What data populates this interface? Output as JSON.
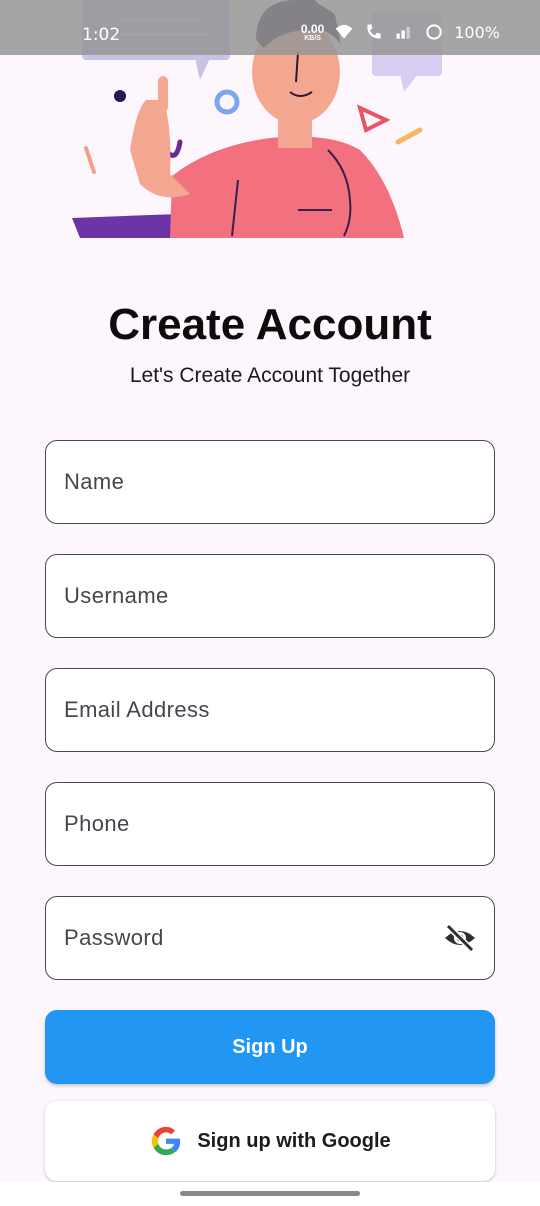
{
  "status_bar": {
    "time": "1:02",
    "net_speed": "0.00",
    "net_unit": "KB/S",
    "battery": "100%"
  },
  "header": {
    "title": "Create Account",
    "subtitle": "Let's Create Account Together"
  },
  "form": {
    "name_placeholder": "Name",
    "username_placeholder": "Username",
    "email_placeholder": "Email Address",
    "phone_placeholder": "Phone",
    "password_placeholder": "Password",
    "password_toggle_icon": "eye-off-icon"
  },
  "actions": {
    "signup_label": "Sign Up",
    "google_label": "Sign up with Google"
  },
  "colors": {
    "primary": "#2196f3",
    "background": "#fdf7fd",
    "field_border": "#4a4750"
  }
}
